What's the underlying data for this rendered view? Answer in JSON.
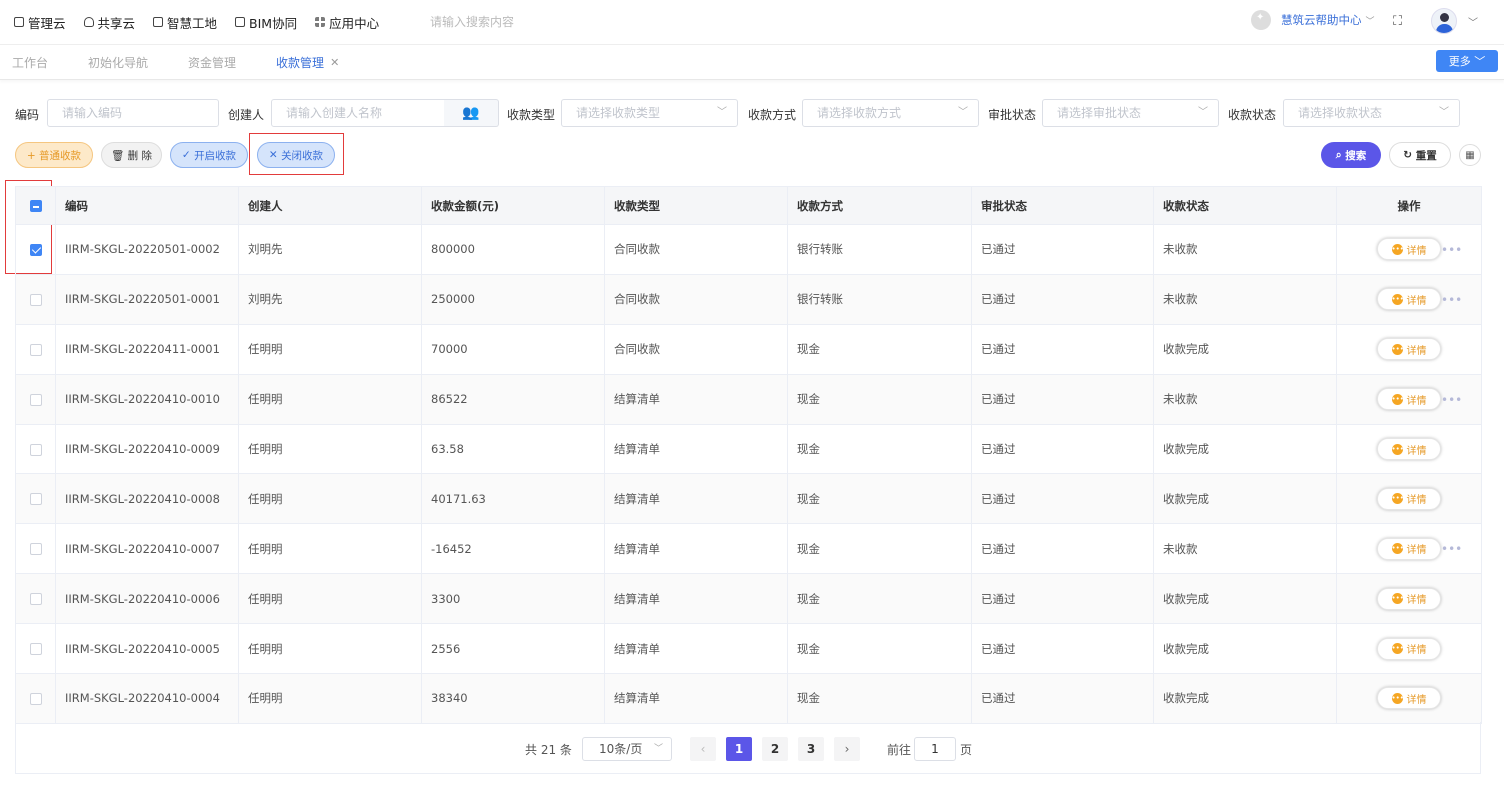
{
  "topnav": {
    "items": [
      {
        "label": "管理云",
        "icon": "book-icon"
      },
      {
        "label": "共享云",
        "icon": "cloud-icon"
      },
      {
        "label": "智慧工地",
        "icon": "book-icon"
      },
      {
        "label": "BIM协同",
        "icon": "box-icon"
      },
      {
        "label": "应用中心",
        "icon": "grid-icon"
      }
    ],
    "search_placeholder": "请输入搜索内容",
    "help_label": "慧筑云帮助中心"
  },
  "tabs": {
    "items": [
      "工作台",
      "初始化导航",
      "资金管理",
      "收款管理"
    ],
    "active": "收款管理",
    "more_label": "更多"
  },
  "filters": {
    "code_label": "编码",
    "code_placeholder": "请输入编码",
    "creator_label": "创建人",
    "creator_placeholder": "请输入创建人名称",
    "type_label": "收款类型",
    "type_placeholder": "请选择收款类型",
    "method_label": "收款方式",
    "method_placeholder": "请选择收款方式",
    "approval_label": "审批状态",
    "approval_placeholder": "请选择审批状态",
    "status_label": "收款状态",
    "status_placeholder": "请选择收款状态"
  },
  "actions": {
    "add": "+ 普通收款",
    "delete": "删 除",
    "open": "开启收款",
    "close": "关闭收款",
    "search": "搜索",
    "reset": "重置"
  },
  "table": {
    "columns": [
      "编码",
      "创建人",
      "收款金额(元)",
      "收款类型",
      "收款方式",
      "审批状态",
      "收款状态",
      "操作"
    ],
    "detail_label": "详情",
    "rows": [
      {
        "code": "IIRM-SKGL-20220501-0002",
        "creator": "刘明先",
        "amount": "800000",
        "type": "合同收款",
        "method": "银行转账",
        "approval": "已通过",
        "status": "未收款",
        "checked": true,
        "more": true
      },
      {
        "code": "IIRM-SKGL-20220501-0001",
        "creator": "刘明先",
        "amount": "250000",
        "type": "合同收款",
        "method": "银行转账",
        "approval": "已通过",
        "status": "未收款",
        "checked": false,
        "more": true
      },
      {
        "code": "IIRM-SKGL-20220411-0001",
        "creator": "任明明",
        "amount": "70000",
        "type": "合同收款",
        "method": "现金",
        "approval": "已通过",
        "status": "收款完成",
        "checked": false,
        "more": false
      },
      {
        "code": "IIRM-SKGL-20220410-0010",
        "creator": "任明明",
        "amount": "86522",
        "type": "结算清单",
        "method": "现金",
        "approval": "已通过",
        "status": "未收款",
        "checked": false,
        "more": true
      },
      {
        "code": "IIRM-SKGL-20220410-0009",
        "creator": "任明明",
        "amount": "63.58",
        "type": "结算清单",
        "method": "现金",
        "approval": "已通过",
        "status": "收款完成",
        "checked": false,
        "more": false
      },
      {
        "code": "IIRM-SKGL-20220410-0008",
        "creator": "任明明",
        "amount": "40171.63",
        "type": "结算清单",
        "method": "现金",
        "approval": "已通过",
        "status": "收款完成",
        "checked": false,
        "more": false
      },
      {
        "code": "IIRM-SKGL-20220410-0007",
        "creator": "任明明",
        "amount": "-16452",
        "type": "结算清单",
        "method": "现金",
        "approval": "已通过",
        "status": "未收款",
        "checked": false,
        "more": true
      },
      {
        "code": "IIRM-SKGL-20220410-0006",
        "creator": "任明明",
        "amount": "3300",
        "type": "结算清单",
        "method": "现金",
        "approval": "已通过",
        "status": "收款完成",
        "checked": false,
        "more": false
      },
      {
        "code": "IIRM-SKGL-20220410-0005",
        "creator": "任明明",
        "amount": "2556",
        "type": "结算清单",
        "method": "现金",
        "approval": "已通过",
        "status": "收款完成",
        "checked": false,
        "more": false
      },
      {
        "code": "IIRM-SKGL-20220410-0004",
        "creator": "任明明",
        "amount": "38340",
        "type": "结算清单",
        "method": "现金",
        "approval": "已通过",
        "status": "收款完成",
        "checked": false,
        "more": false
      }
    ]
  },
  "pagination": {
    "total": "共 21 条",
    "page_size": "10条/页",
    "pages": [
      "1",
      "2",
      "3"
    ],
    "current": "1",
    "goto_prefix": "前往",
    "goto_value": "1",
    "goto_suffix": "页"
  },
  "colors": {
    "primary": "#5b56e8",
    "blue": "#3f86f5",
    "orange": "#e69a28",
    "highlight": "#e23b3b"
  }
}
